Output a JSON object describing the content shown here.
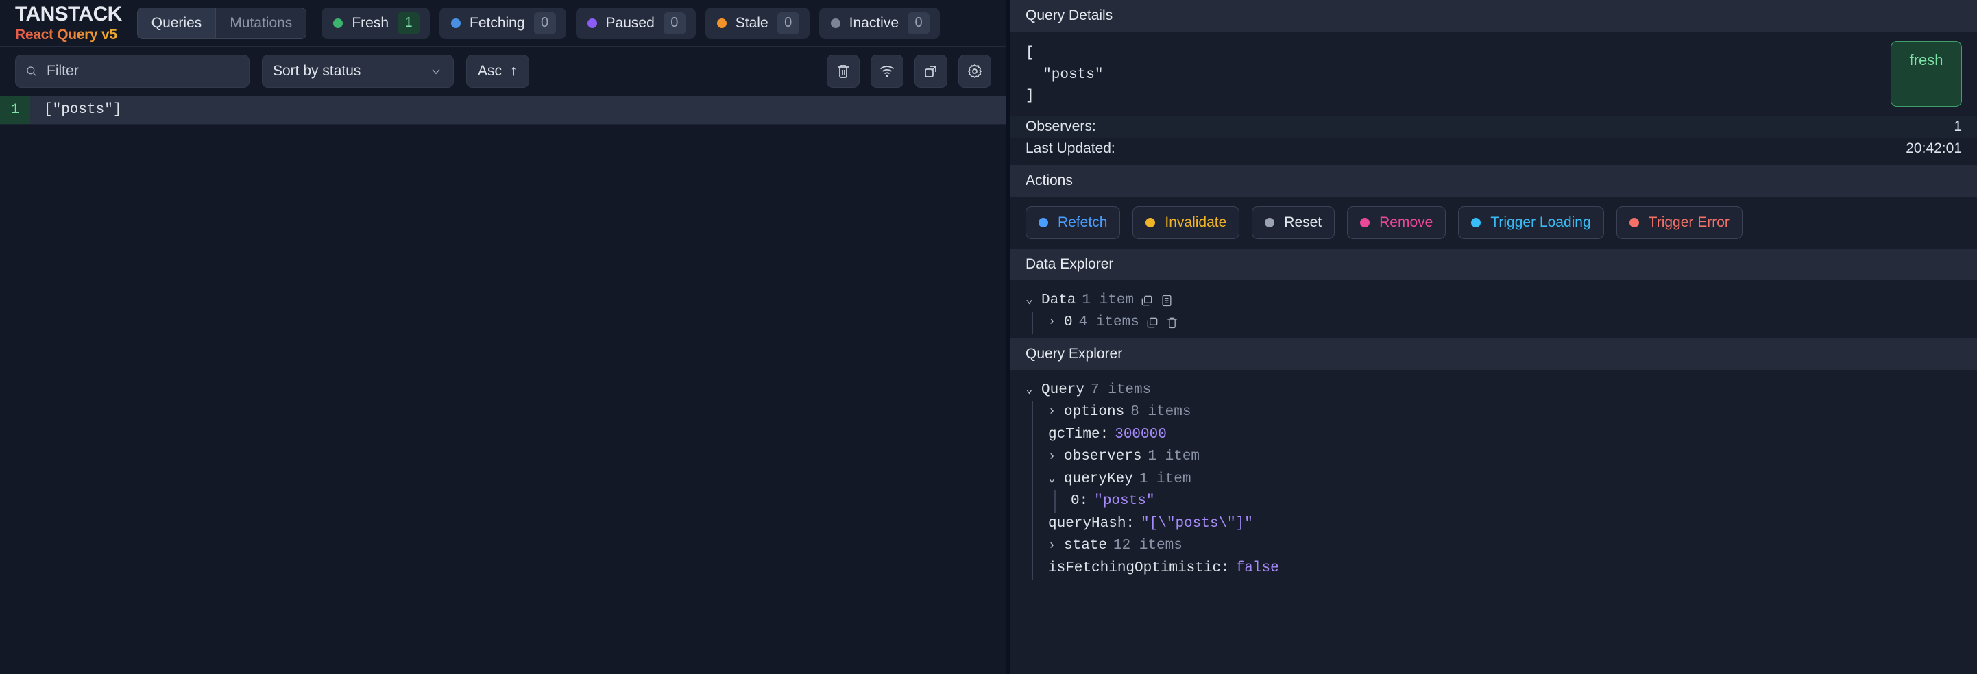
{
  "brand": {
    "title": "TANSTACK",
    "subtitle": "React Query v5"
  },
  "tabs": {
    "queries": "Queries",
    "mutations": "Mutations"
  },
  "status_badges": [
    {
      "label": "Fresh",
      "count": "1",
      "color": "#3cb46e",
      "active": true
    },
    {
      "label": "Fetching",
      "count": "0",
      "color": "#4a90e2",
      "active": false
    },
    {
      "label": "Paused",
      "count": "0",
      "color": "#8b5cf6",
      "active": false
    },
    {
      "label": "Stale",
      "count": "0",
      "color": "#f0932b",
      "active": false
    },
    {
      "label": "Inactive",
      "count": "0",
      "color": "#7c8495",
      "active": false
    }
  ],
  "controls": {
    "filter_placeholder": "Filter",
    "filter_value": "",
    "sort_selected": "Sort by status",
    "sort_direction": "Asc",
    "sort_arrow": "↑",
    "icons": [
      "trash-icon",
      "wifi-icon",
      "expand-icon",
      "gear-icon"
    ]
  },
  "query_list": [
    {
      "observers": "1",
      "key": "[\"posts\"]"
    }
  ],
  "details": {
    "section_title": "Query Details",
    "query_key_json": "[\n  \"posts\"\n]",
    "status_badge": "fresh",
    "observers_label": "Observers:",
    "observers_value": "1",
    "last_updated_label": "Last Updated:",
    "last_updated_value": "20:42:01"
  },
  "actions": {
    "section_title": "Actions",
    "buttons": [
      {
        "label": "Refetch",
        "color": "#4a9eff"
      },
      {
        "label": "Invalidate",
        "color": "#f0b429"
      },
      {
        "label": "Reset",
        "color": "#9aa3b4"
      },
      {
        "label": "Remove",
        "color": "#ec4899"
      },
      {
        "label": "Trigger Loading",
        "color": "#38bdf8"
      },
      {
        "label": "Trigger Error",
        "color": "#f47068"
      }
    ]
  },
  "data_explorer": {
    "section_title": "Data Explorer",
    "root_label": "Data",
    "root_sub": "1 item",
    "child_label": "0",
    "child_sub": "4 items"
  },
  "query_explorer": {
    "section_title": "Query Explorer",
    "root_label": "Query",
    "root_sub": "7 items",
    "rows": {
      "options_label": "options",
      "options_sub": "8 items",
      "gctime_key": "gcTime:",
      "gctime_val": "300000",
      "observers_label": "observers",
      "observers_sub": "1 item",
      "querykey_label": "queryKey",
      "querykey_sub": "1 item",
      "querykey_child_key": "0:",
      "querykey_child_val": "\"posts\"",
      "queryhash_key": "queryHash:",
      "queryhash_val": "\"[\\\"posts\\\"]\"",
      "state_label": "state",
      "state_sub": "12 items",
      "optimistic_key": "isFetchingOptimistic:",
      "optimistic_val": "false"
    }
  }
}
